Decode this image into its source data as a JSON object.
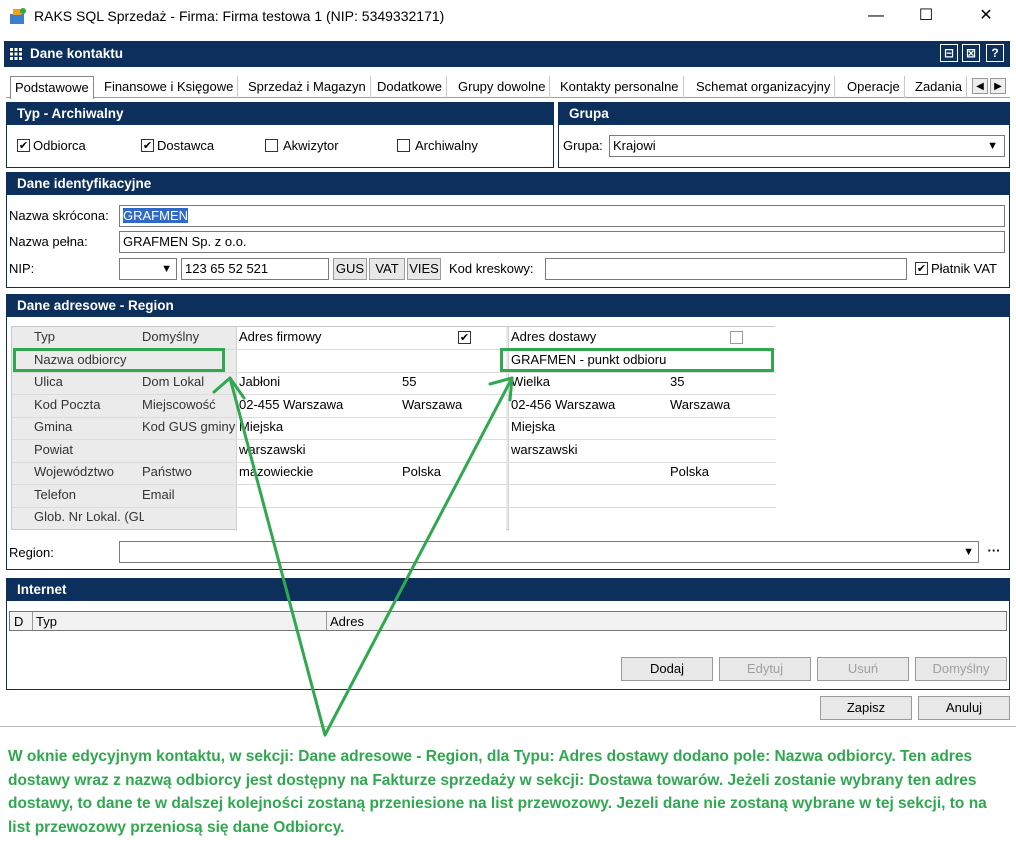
{
  "window": {
    "title": "RAKS SQL Sprzedaż - Firma: Firma testowa 1  (NIP: 5349332171)",
    "minimize": "—",
    "maximize": "☐",
    "close": "✕"
  },
  "dialog": {
    "title": "Dane kontaktu",
    "header_buttons": [
      "⊟",
      "⊠",
      "?"
    ]
  },
  "tabs": [
    "Podstawowe",
    "Finansowe i Księgowe",
    "Sprzedaż i Magazyn",
    "Dodatkowe",
    "Grupy dowolne",
    "Kontakty personalne",
    "Schemat organizacyjny",
    "Operacje",
    "Zadania"
  ],
  "typ": {
    "title": "Typ - Archiwalny",
    "checkboxes": [
      {
        "label": "Odbiorca",
        "checked": true
      },
      {
        "label": "Dostawca",
        "checked": true
      },
      {
        "label": "Akwizytor",
        "checked": false
      },
      {
        "label": "Archiwalny",
        "checked": false
      }
    ]
  },
  "grupa": {
    "title": "Grupa",
    "label": "Grupa:",
    "value": "Krajowi"
  },
  "ident": {
    "title": "Dane identyfikacyjne",
    "short_label": "Nazwa skrócona:",
    "short_value": "GRAFMEN",
    "full_label": "Nazwa pełna:",
    "full_value": "GRAFMEN Sp. z o.o.",
    "nip_label": "NIP:",
    "nip_value": "123 65 52 521",
    "gus": "GUS",
    "vat": "VAT",
    "vies": "VIES",
    "barcode_label": "Kod kreskowy:",
    "vat_payer_label": "Płatnik VAT",
    "vat_payer_checked": true
  },
  "address": {
    "title": "Dane adresowe - Region",
    "rows": [
      {
        "l1": "Typ",
        "l2": "Domyślny",
        "a": "Adres firmowy",
        "b": "",
        "c": "Adres dostawy",
        "d": ""
      },
      {
        "l1": "Nazwa odbiorcy",
        "l2": "",
        "a": "",
        "b": "",
        "c": "GRAFMEN -  punkt odbioru paczek",
        "d": ""
      },
      {
        "l1": "Ulica",
        "l2": "Dom  Lokal",
        "a": "Jabłoni",
        "b": "55",
        "c": "Wielka",
        "d": "35"
      },
      {
        "l1": "Kod  Poczta",
        "l2": "Miejscowość",
        "a": "02-455 Warszawa",
        "b": "Warszawa",
        "c": "02-456 Warszawa",
        "d": "Warszawa"
      },
      {
        "l1": "Gmina",
        "l2": "Kod GUS gminy",
        "a": "Miejska",
        "b": "",
        "c": "Miejska",
        "d": ""
      },
      {
        "l1": "Powiat",
        "l2": "",
        "a": "warszawski",
        "b": "",
        "c": "warszawski",
        "d": ""
      },
      {
        "l1": "Województwo",
        "l2": "Państwo",
        "a": "mazowieckie",
        "b": "Polska",
        "c": "",
        "d": "Polska"
      },
      {
        "l1": "Telefon",
        "l2": "Email",
        "a": "",
        "b": "",
        "c": "",
        "d": ""
      },
      {
        "l1": "Glob. Nr Lokal. (GLN)",
        "l2": "",
        "a": "",
        "b": "",
        "c": "",
        "d": ""
      }
    ],
    "region_label": "Region:",
    "region_ellipsis": "···"
  },
  "internet": {
    "title": "Internet",
    "col_d": "D",
    "col_typ": "Typ",
    "col_adres": "Adres",
    "add": "Dodaj",
    "edit": "Edytuj",
    "remove": "Usuń",
    "default": "Domyślny"
  },
  "footer": {
    "save": "Zapisz",
    "cancel": "Anuluj"
  },
  "annotation": "W oknie edycyjnym kontaktu, w sekcji: Dane adresowe - Region, dla Typu: Adres dostawy dodano pole: Nazwa odbiorcy. Ten adres dostawy wraz z nazwą odbiorcy jest dostępny na Fakturze sprzedaży w sekcji: Dostawa towarów. Jeżeli zostanie wybrany ten adres dostawy, to dane te w dalszej kolejności zostaną przeniesione na list przewozowy. Jezeli dane nie zostaną wybrane w tej sekcji, to na list przewozowy przeniosą się dane Odbiorcy.",
  "colors": {
    "header": "#0c2f5c",
    "annotation": "#2fa84f"
  }
}
